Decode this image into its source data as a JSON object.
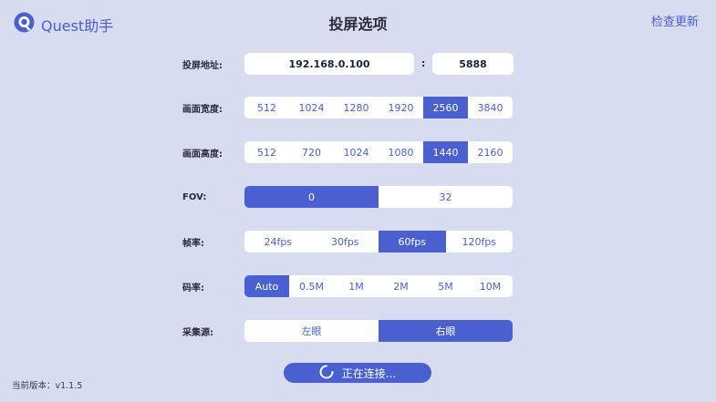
{
  "app": {
    "name": "Quest助手",
    "title": "投屏选项",
    "update_label": "检查更新",
    "version_label": "当前版本：v1.1.5"
  },
  "colors": {
    "accent": "#4a5fd0",
    "background": "#d8dcf1",
    "panel": "#ffffff"
  },
  "address": {
    "label": "投屏地址:",
    "ip": "192.168.0.100",
    "separator": ":",
    "port": "5888"
  },
  "width": {
    "label": "画面宽度:",
    "options": [
      "512",
      "1024",
      "1280",
      "1920",
      "2560",
      "3840"
    ],
    "selected": "2560"
  },
  "height": {
    "label": "画面高度:",
    "options": [
      "512",
      "720",
      "1024",
      "1080",
      "1440",
      "2160"
    ],
    "selected": "1440"
  },
  "fov": {
    "label": "FOV:",
    "options": [
      "0",
      "32"
    ],
    "selected": "0"
  },
  "framerate": {
    "label": "帧率:",
    "options": [
      "24fps",
      "30fps",
      "60fps",
      "120fps"
    ],
    "selected": "60fps"
  },
  "bitrate": {
    "label": "码率:",
    "options": [
      "Auto",
      "0.5M",
      "1M",
      "2M",
      "5M",
      "10M"
    ],
    "selected": "Auto"
  },
  "source": {
    "label": "采集源:",
    "options": [
      "左眼",
      "右眼"
    ],
    "selected": "右眼"
  },
  "connect": {
    "label": "正在连接...",
    "icon": "spinner-icon"
  },
  "icons": {
    "logo": "quest-logo-icon"
  }
}
